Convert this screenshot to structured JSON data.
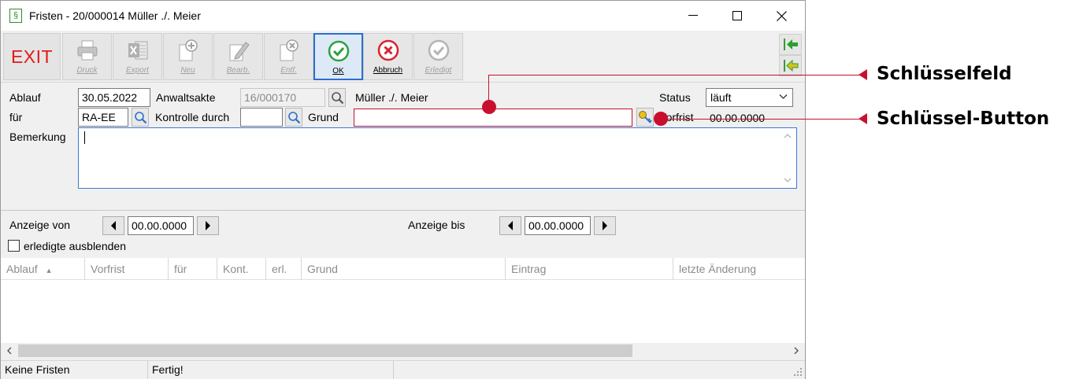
{
  "window": {
    "title": "Fristen - 20/000014 Müller ./. Meier",
    "app_icon_glyph": "§"
  },
  "toolbar": {
    "exit_label": "EXIT",
    "buttons": [
      {
        "label": "Druck",
        "icon": "printer-icon",
        "enabled": false
      },
      {
        "label": "Export",
        "icon": "excel-icon",
        "enabled": false
      },
      {
        "label": "Neu",
        "icon": "add-icon",
        "enabled": false
      },
      {
        "label": "Bearb.",
        "icon": "edit-icon",
        "enabled": false
      },
      {
        "label": "Entf.",
        "icon": "delete-icon",
        "enabled": false
      },
      {
        "label": "OK",
        "icon": "check-circle-icon",
        "enabled": true,
        "accent": "#2ea043"
      },
      {
        "label": "Abbruch",
        "icon": "cancel-circle-icon",
        "enabled": true,
        "accent": "#d9232e"
      },
      {
        "label": "Erledigt",
        "icon": "done-icon",
        "enabled": false
      }
    ]
  },
  "form": {
    "ablauf_label": "Ablauf",
    "ablauf_value": "30.05.2022",
    "anwaltsakte_label": "Anwaltsakte",
    "anwaltsakte_value": "16/000170",
    "parteien": "Müller ./. Meier",
    "status_label": "Status",
    "status_value": "läuft",
    "fuer_label": "für",
    "fuer_value": "RA-EE",
    "kontrolle_label": "Kontrolle durch",
    "kontrolle_value": "",
    "grund_label": "Grund",
    "grund_value": "",
    "vorfrist_label": "Vorfrist",
    "vorfrist_value": "00.00.0000",
    "bemerkung_label": "Bemerkung",
    "bemerkung_value": ""
  },
  "filter": {
    "anzeige_von_label": "Anzeige von",
    "anzeige_von_value": "00.00.0000",
    "anzeige_bis_label": "Anzeige bis",
    "anzeige_bis_value": "00.00.0000",
    "erledigte_label": "erledigte ausblenden",
    "erledigte_checked": false
  },
  "grid": {
    "columns": [
      "Ablauf",
      "Vorfrist",
      "für",
      "Kont.",
      "erl.",
      "Grund",
      "Eintrag",
      "letzte Änderung"
    ],
    "sort_glyph": "▲",
    "rows": []
  },
  "statusbar": {
    "left": "Keine Fristen",
    "middle": "Fertig!"
  },
  "callouts": {
    "schluesselfeld": "Schlüsselfeld",
    "schluessel_button": "Schlüssel-Button",
    "color": "#c8102e"
  }
}
